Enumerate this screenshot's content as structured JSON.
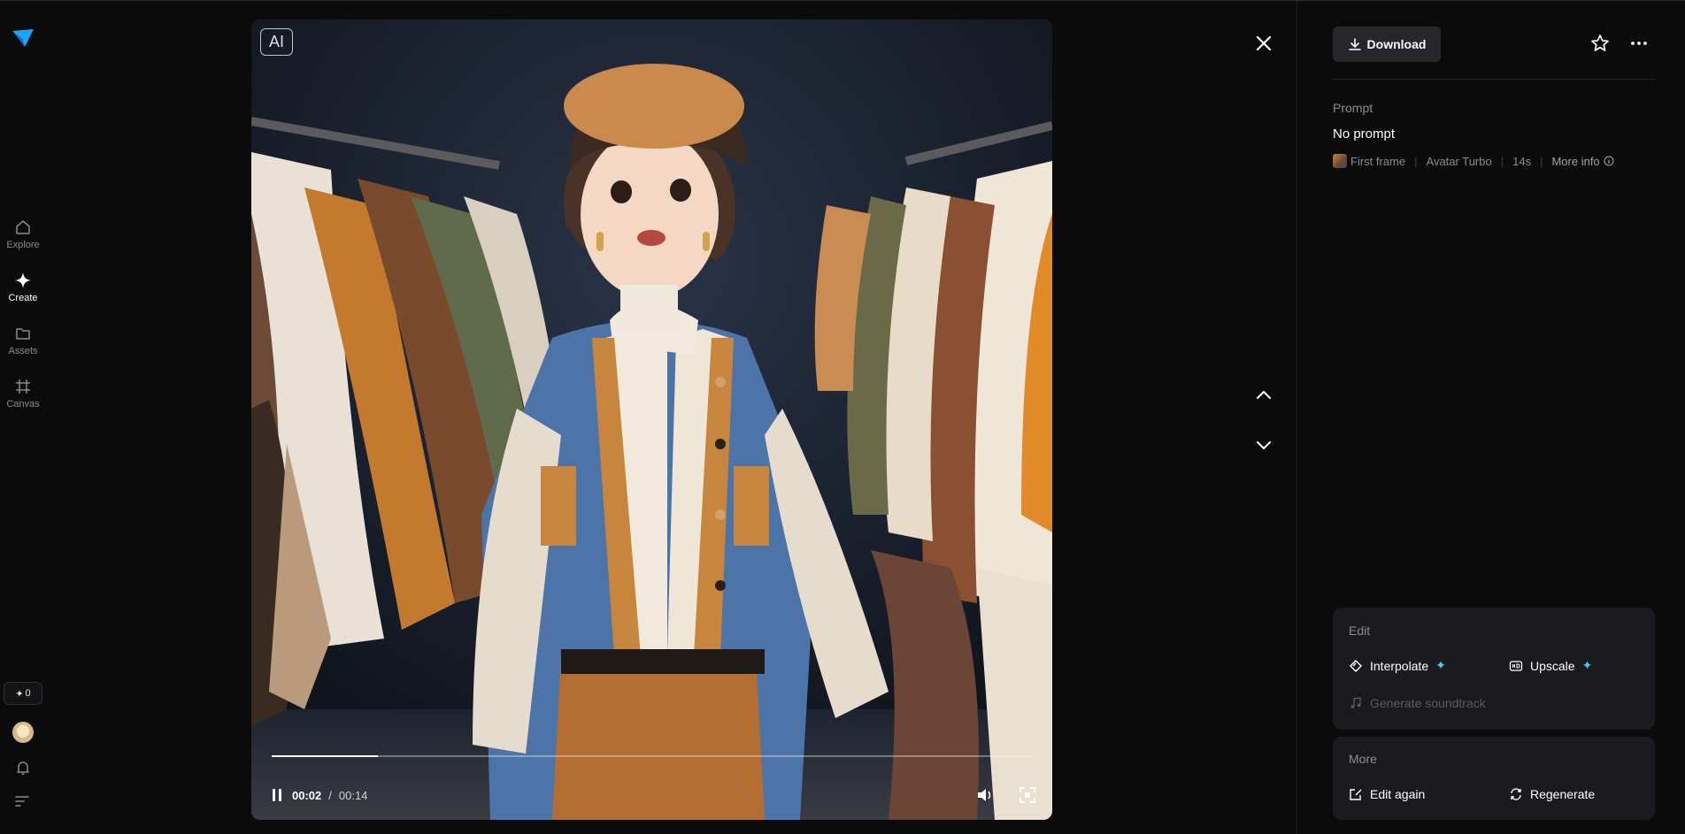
{
  "nav": {
    "items": [
      {
        "label": "Explore",
        "icon": "home-icon"
      },
      {
        "label": "Create",
        "icon": "sparkle-icon",
        "active": true
      },
      {
        "label": "Assets",
        "icon": "folder-icon"
      },
      {
        "label": "Canvas",
        "icon": "canvas-icon"
      }
    ],
    "credits": "0",
    "credits_icon": "sparkle-icon"
  },
  "media": {
    "badge": "AI",
    "time_current": "00:02",
    "time_separator": "/",
    "time_total": "00:14",
    "progress_fraction": 0.14
  },
  "panel": {
    "download_label": "Download",
    "prompt_label": "Prompt",
    "prompt_text": "No prompt",
    "meta": {
      "first_frame": "First frame",
      "model": "Avatar Turbo",
      "duration": "14s",
      "more_info": "More info"
    },
    "edit": {
      "title": "Edit",
      "interpolate": "Interpolate",
      "upscale": "Upscale",
      "soundtrack": "Generate soundtrack"
    },
    "more": {
      "title": "More",
      "edit_again": "Edit again",
      "regenerate": "Regenerate"
    }
  },
  "colors": {
    "accent": "#34d6ff",
    "background": "#0b0b0c",
    "card": "#1b1b1f"
  }
}
